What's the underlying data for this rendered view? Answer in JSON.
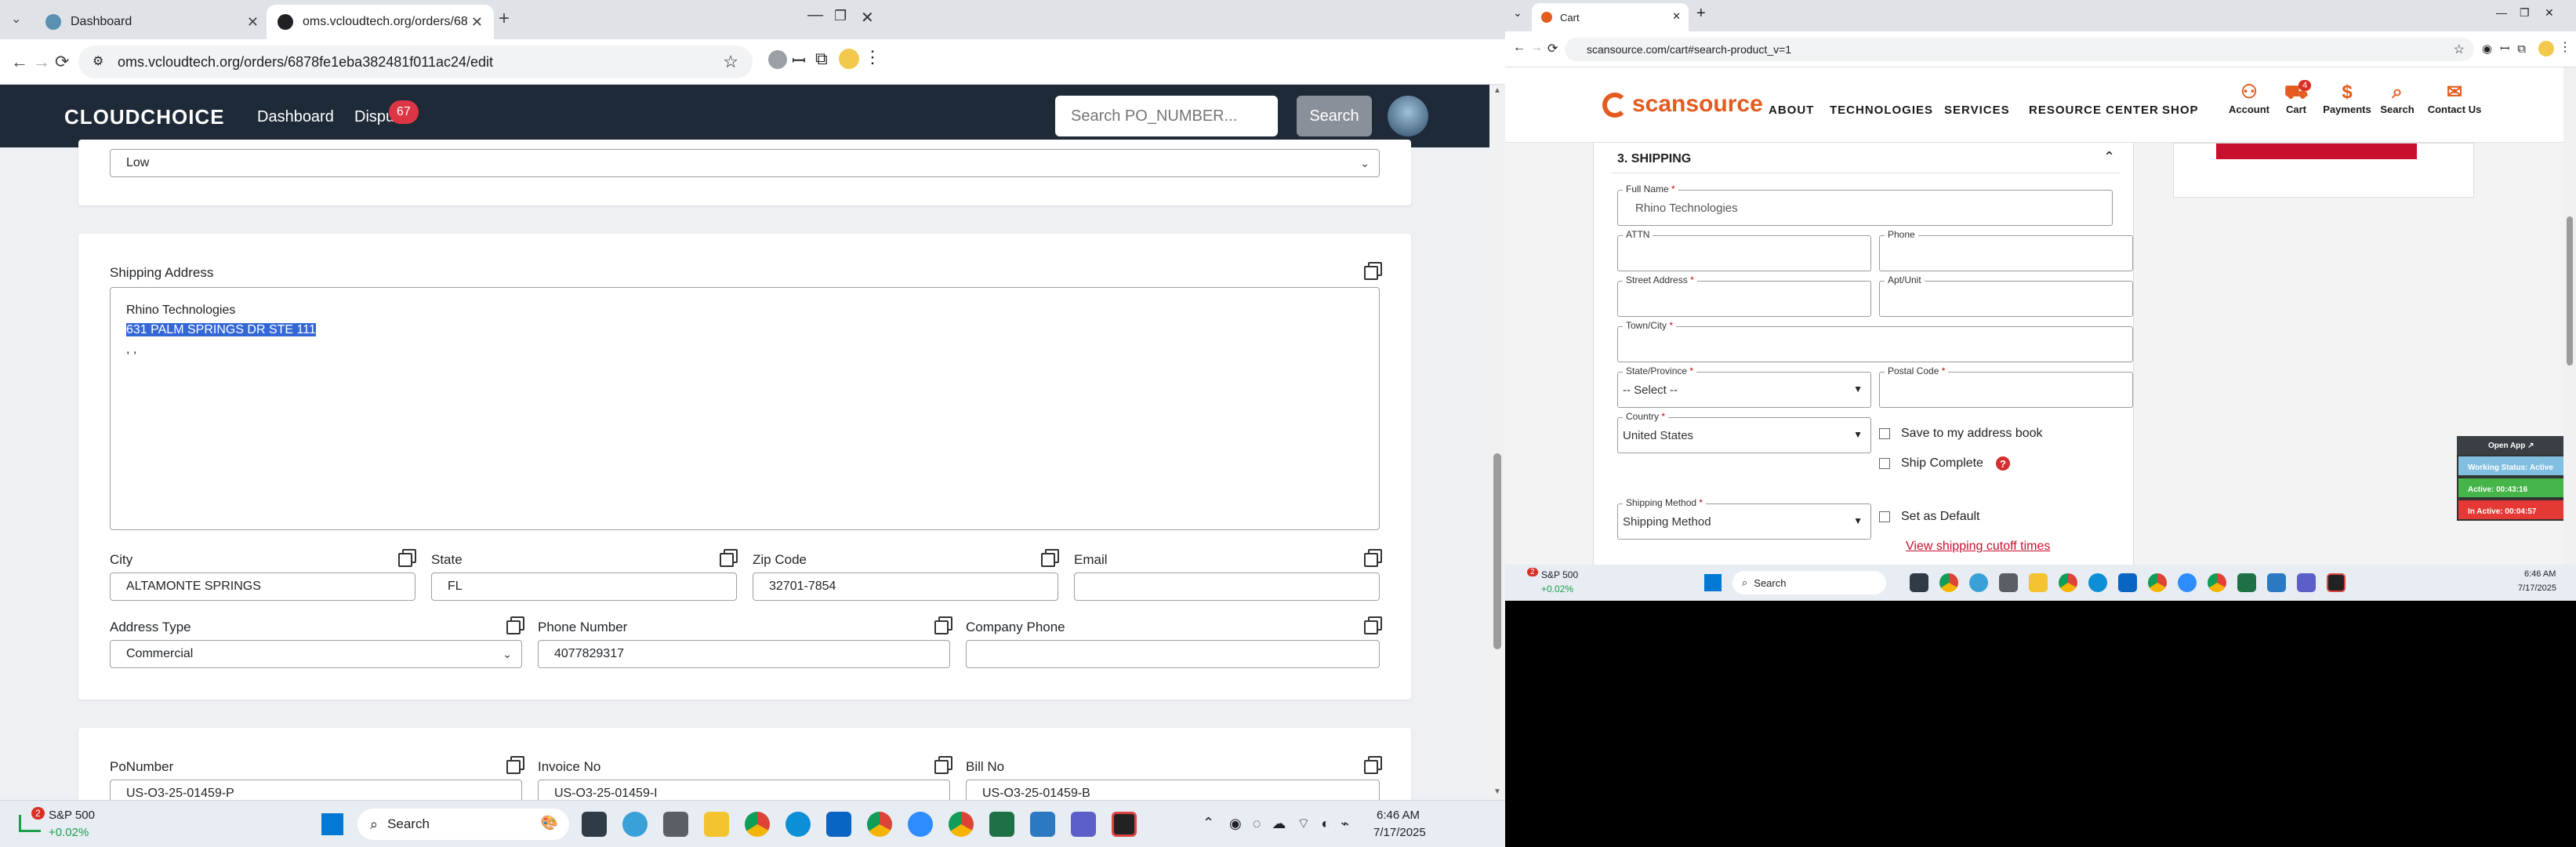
{
  "left_browser": {
    "tabs": [
      {
        "title": "Dashboard",
        "active": false
      },
      {
        "title": "oms.vcloudtech.org/orders/68",
        "active": true
      }
    ],
    "url": "oms.vcloudtech.org/orders/6878fe1eba382481f011ac24/edit",
    "new_tab_symbol": "+",
    "nav": {
      "logo": "CLOUDCHOICE",
      "dashboard": "Dashboard",
      "disputes": "Dispu",
      "disputes_badge": "67",
      "search_placeholder": "Search PO_NUMBER...",
      "search_button": "Search"
    },
    "priority_value": "Low",
    "shipping": {
      "label": "Shipping Address",
      "line1": "Rhino Technologies",
      "line2": "631 PALM SPRINGS DR STE 111",
      "line3": ", ,"
    },
    "city": {
      "label": "City",
      "value": "ALTAMONTE SPRINGS"
    },
    "state": {
      "label": "State",
      "value": "FL"
    },
    "zip": {
      "label": "Zip Code",
      "value": "32701-7854"
    },
    "email": {
      "label": "Email",
      "value": ""
    },
    "address_type": {
      "label": "Address Type",
      "value": "Commercial"
    },
    "phone": {
      "label": "Phone Number",
      "value": "4077829317"
    },
    "company_phone": {
      "label": "Company Phone",
      "value": ""
    },
    "po": {
      "label": "PoNumber",
      "value": "US-O3-25-01459-P"
    },
    "invoice": {
      "label": "Invoice No",
      "value": "US-O3-25-01459-I"
    },
    "bill": {
      "label": "Bill No",
      "value": "US-O3-25-01459-B"
    }
  },
  "left_taskbar": {
    "stock_name": "S&P 500",
    "stock_change": "+0.02%",
    "stock_badge": "2",
    "search": "Search",
    "time": "6:46 AM",
    "date": "7/17/2025"
  },
  "right_browser": {
    "tab_title": "Cart",
    "url": "scansource.com/cart#search-product_v=1",
    "brand": "scansource",
    "menu": [
      "ABOUT",
      "TECHNOLOGIES",
      "SERVICES",
      "RESOURCE CENTER",
      "SHOP"
    ],
    "icons": [
      "Account",
      "Cart",
      "Payments",
      "Search",
      "Contact Us"
    ],
    "cart_count": "4",
    "section_title": "3. SHIPPING",
    "full_name": {
      "label": "Full Name",
      "value": "Rhino Technologies"
    },
    "attn": {
      "label": "ATTN",
      "value": ""
    },
    "phone": {
      "label": "Phone",
      "value": ""
    },
    "street": {
      "label": "Street Address",
      "value": ""
    },
    "apt": {
      "label": "Apt/Unit",
      "value": ""
    },
    "town": {
      "label": "Town/City",
      "value": ""
    },
    "state": {
      "label": "State/Province",
      "value": "-- Select --"
    },
    "postal": {
      "label": "Postal Code",
      "value": ""
    },
    "country": {
      "label": "Country",
      "value": "United States"
    },
    "save_book": "Save to my address book",
    "ship_complete": "Ship Complete",
    "shipping_method": {
      "label": "Shipping Method",
      "value": "Shipping Method"
    },
    "set_default": "Set as Default",
    "cutoff_link": "View shipping cutoff times",
    "required_mark": "*",
    "help_mark": "?",
    "widget": {
      "open": "Open App ↗",
      "status": "Working Status: Active",
      "active": "Active: 00:43:16",
      "inactive": "In Active: 00:04:57"
    }
  },
  "right_taskbar": {
    "stock_name": "S&P 500",
    "stock_change": "+0.02%",
    "stock_badge": "2",
    "search": "Search",
    "time": "6:46 AM",
    "date": "7/17/2025"
  },
  "colors": {
    "nav_dark": "#1e2a38",
    "selection": "#3367d6",
    "badge_red": "#dc3545",
    "scansource_orange": "#e35b1e",
    "link_red": "#c8102e"
  }
}
